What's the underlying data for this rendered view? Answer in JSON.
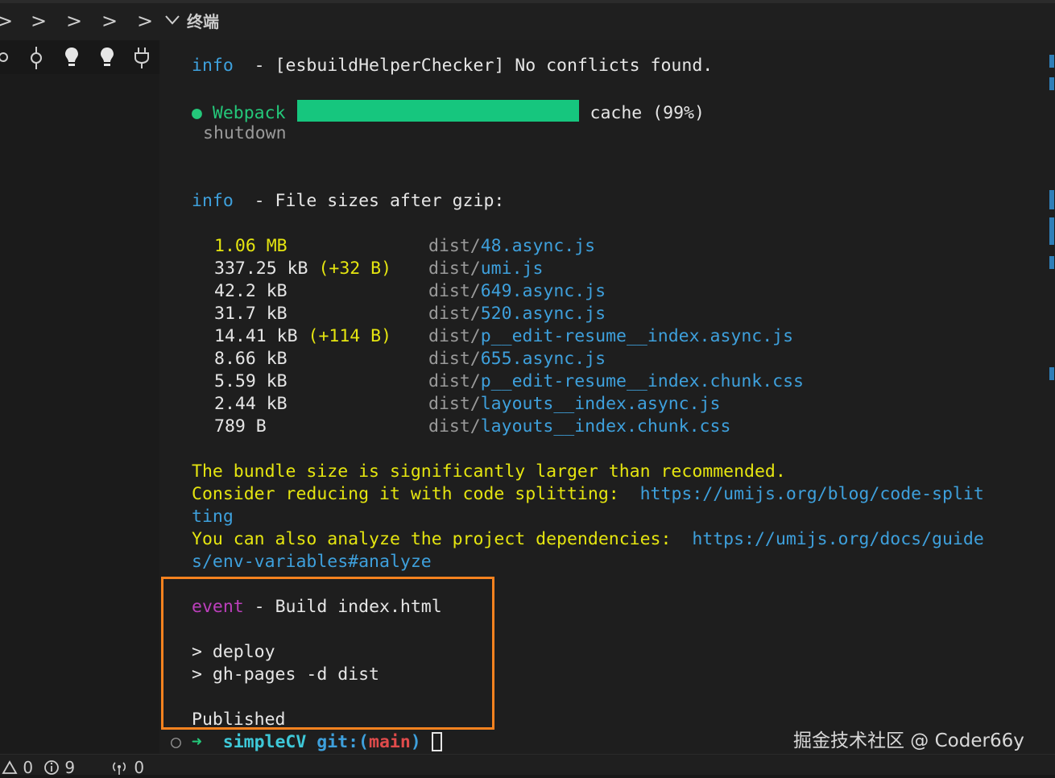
{
  "topbar": {
    "chevrons": [
      ">",
      ">",
      ">",
      ">",
      ">"
    ],
    "panel_toggle_icon": "chevron-down",
    "panel_title": "终端"
  },
  "toolbar_icons": [
    "git-branch-icon",
    "git-commit-icon",
    "lightbulb-icon",
    "lightbulb-icon",
    "plug-icon"
  ],
  "terminal": {
    "line_info1": {
      "tag": "info",
      "text": "  - [esbuildHelperChecker] No conflicts found."
    },
    "webpack": {
      "bullet": "●",
      "label": "Webpack",
      "progress": 99,
      "status": "cache (99%)",
      "substatus": "shutdown"
    },
    "line_info2": {
      "tag": "info",
      "text": "  - File sizes after gzip:"
    },
    "file_sizes": [
      {
        "size": "1.06 MB",
        "delta": "",
        "dir": "dist/",
        "file": "48.async.js",
        "size_color": "yellow"
      },
      {
        "size": "337.25 kB",
        "delta": "(+32 B)",
        "dir": "dist/",
        "file": "umi.js",
        "size_color": "white"
      },
      {
        "size": "42.2 kB",
        "delta": "",
        "dir": "dist/",
        "file": "649.async.js",
        "size_color": "white"
      },
      {
        "size": "31.7 kB",
        "delta": "",
        "dir": "dist/",
        "file": "520.async.js",
        "size_color": "white"
      },
      {
        "size": "14.41 kB",
        "delta": "(+114 B)",
        "dir": "dist/",
        "file": "p__edit-resume__index.async.js",
        "size_color": "white"
      },
      {
        "size": "8.66 kB",
        "delta": "",
        "dir": "dist/",
        "file": "655.async.js",
        "size_color": "white"
      },
      {
        "size": "5.59 kB",
        "delta": "",
        "dir": "dist/",
        "file": "p__edit-resume__index.chunk.css",
        "size_color": "white"
      },
      {
        "size": "2.44 kB",
        "delta": "",
        "dir": "dist/",
        "file": "layouts__index.async.js",
        "size_color": "white"
      },
      {
        "size": "789 B",
        "delta": "",
        "dir": "dist/",
        "file": "layouts__index.chunk.css",
        "size_color": "white"
      }
    ],
    "warning1": "The bundle size is significantly larger than recommended.",
    "warning2_text": "Consider reducing it with code splitting:  ",
    "warning2_link_a": "https://umijs.org/blog/code-split",
    "warning2_link_b": "ting",
    "warning3_text": "You can also analyze the project dependencies:  ",
    "warning3_link_a": "https://umijs.org/docs/guide",
    "warning3_link_b": "s/env-variables#analyze",
    "event": {
      "tag": "event",
      "text": " - Build index.html"
    },
    "deploy1": "> deploy",
    "deploy2": "> gh-pages -d dist",
    "published": "Published",
    "prompt": {
      "circle": "○",
      "arrow": "➜",
      "dir": "simpleCV",
      "git": "git:(",
      "branch": "main",
      "git_close": ")"
    }
  },
  "statusbar": {
    "warnings_icon": "warning-icon",
    "warnings": "0",
    "info_icon": "info-icon",
    "info": "9",
    "ports_icon": "broadcast-icon",
    "ports": "0"
  },
  "watermark": "掘金技术社区 @ Coder66y",
  "colors": {
    "accent_highlight": "#f6821f",
    "progress": "#16c67e",
    "link": "#3ea0dc",
    "warning_text": "#e5e510"
  }
}
